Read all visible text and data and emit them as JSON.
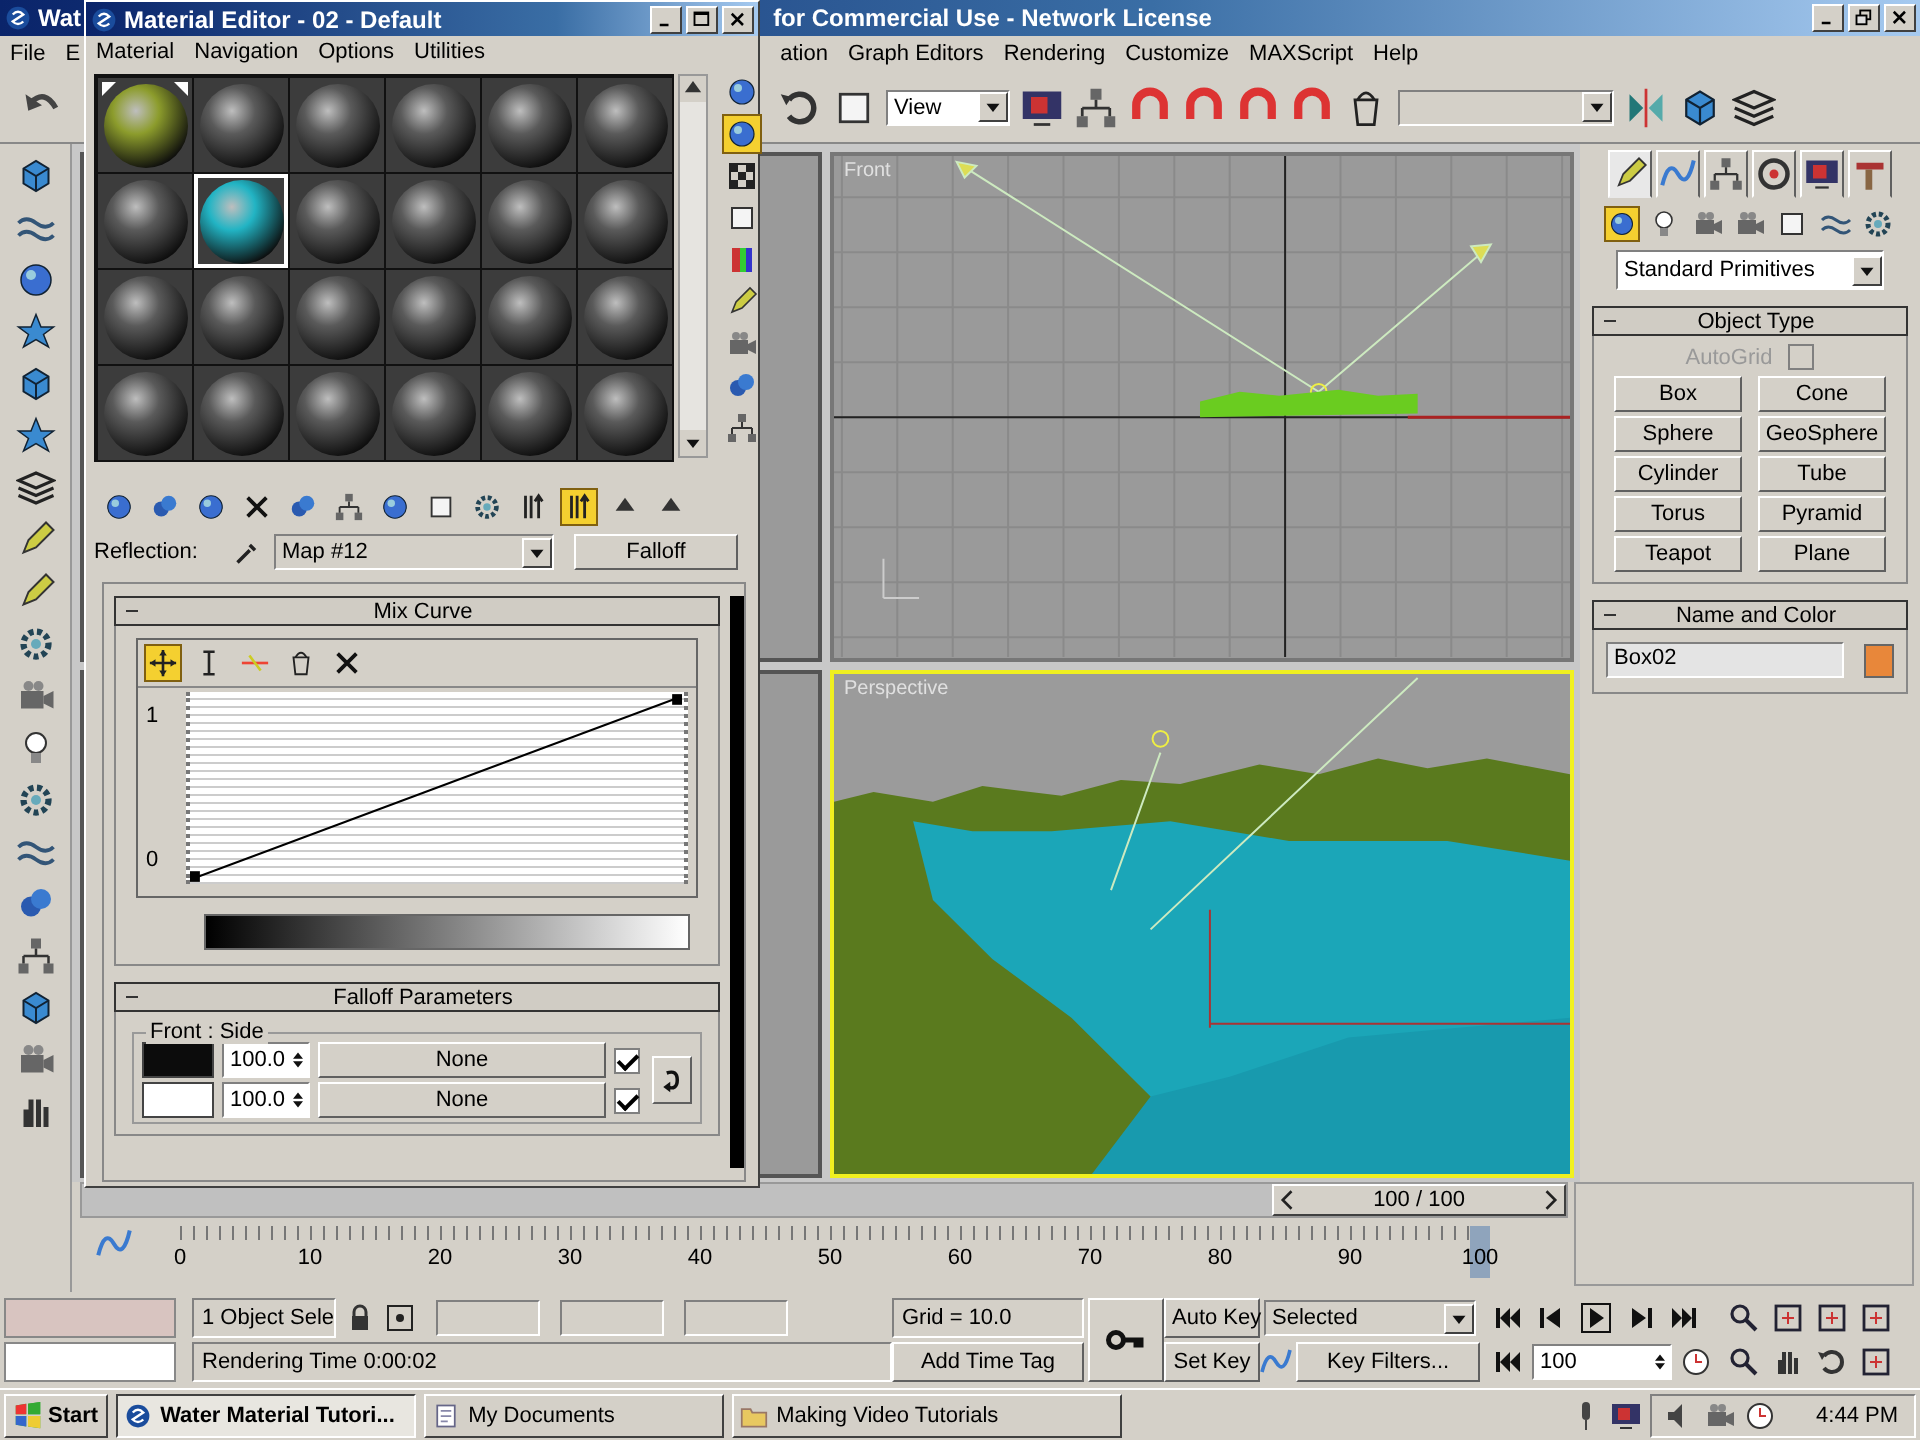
{
  "main_window": {
    "title_left": "Wat",
    "title_right": "for Commercial Use - Network License",
    "menu": [
      "File",
      "E",
      "ation",
      "Graph Editors",
      "Rendering",
      "Customize",
      "MAXScript",
      "Help"
    ],
    "view_dropdown": "View"
  },
  "viewports": [
    {
      "label": "Front",
      "active": false
    },
    {
      "label": "Perspective",
      "active": true
    }
  ],
  "command_panel": {
    "tabs": [
      {
        "selected": true
      },
      {
        "selected": false
      },
      {
        "selected": false
      },
      {
        "selected": false
      },
      {
        "selected": false
      },
      {
        "selected": false
      }
    ],
    "categories": [
      {
        "selected": true
      },
      {
        "selected": false
      },
      {
        "selected": false
      },
      {
        "selected": false
      },
      {
        "selected": false
      },
      {
        "selected": false
      },
      {
        "selected": false
      }
    ],
    "dropdown": "Standard Primitives",
    "object_type": {
      "title": "Object Type",
      "autogrid": {
        "label": "AutoGrid",
        "checked": false,
        "disabled": true
      },
      "buttons": [
        "Box",
        "Cone",
        "Sphere",
        "GeoSphere",
        "Cylinder",
        "Tube",
        "Torus",
        "Pyramid",
        "Teapot",
        "Plane"
      ]
    },
    "name_and_color": {
      "title": "Name and Color",
      "name": "Box02",
      "color": "#e8873a"
    }
  },
  "material_editor": {
    "title": "Material Editor - 02 - Default",
    "menu": [
      "Material",
      "Navigation",
      "Options",
      "Utilities"
    ],
    "slots": [
      {
        "color": "#8c9c2c",
        "hot": true,
        "selected": false
      },
      {
        "color": "#5a5a5a",
        "hot": false,
        "selected": false
      },
      {
        "color": "#5a5a5a",
        "hot": false,
        "selected": false
      },
      {
        "color": "#5a5a5a",
        "hot": false,
        "selected": false
      },
      {
        "color": "#5a5a5a",
        "hot": false,
        "selected": false
      },
      {
        "color": "#5a5a5a",
        "hot": false,
        "selected": false
      },
      {
        "color": "#5a5a5a",
        "hot": false,
        "selected": false
      },
      {
        "color": "#22b4c4",
        "hot": false,
        "selected": true
      },
      {
        "color": "#5a5a5a",
        "hot": false,
        "selected": false
      },
      {
        "color": "#5a5a5a",
        "hot": false,
        "selected": false
      },
      {
        "color": "#5a5a5a",
        "hot": false,
        "selected": false
      },
      {
        "color": "#5a5a5a",
        "hot": false,
        "selected": false
      },
      {
        "color": "#5a5a5a",
        "hot": false,
        "selected": false
      },
      {
        "color": "#5a5a5a",
        "hot": false,
        "selected": false
      },
      {
        "color": "#5a5a5a",
        "hot": false,
        "selected": false
      },
      {
        "color": "#5a5a5a",
        "hot": false,
        "selected": false
      },
      {
        "color": "#5a5a5a",
        "hot": false,
        "selected": false
      },
      {
        "color": "#5a5a5a",
        "hot": false,
        "selected": false
      },
      {
        "color": "#5a5a5a",
        "hot": false,
        "selected": false
      },
      {
        "color": "#5a5a5a",
        "hot": false,
        "selected": false
      },
      {
        "color": "#5a5a5a",
        "hot": false,
        "selected": false
      },
      {
        "color": "#5a5a5a",
        "hot": false,
        "selected": false
      },
      {
        "color": "#5a5a5a",
        "hot": false,
        "selected": false
      },
      {
        "color": "#5a5a5a",
        "hot": false,
        "selected": false
      }
    ],
    "side_tools": [
      {
        "on": false
      },
      {
        "on": true
      },
      {
        "on": false
      },
      {
        "on": false
      },
      {
        "on": false
      },
      {
        "on": false
      },
      {
        "on": false
      },
      {
        "on": false
      },
      {
        "on": false
      }
    ],
    "tools": [
      {
        "on": false
      },
      {
        "on": false
      },
      {
        "on": false
      },
      {
        "on": false
      },
      {
        "on": false
      },
      {
        "on": false
      },
      {
        "on": false
      },
      {
        "on": false
      },
      {
        "on": false
      },
      {
        "on": false
      },
      {
        "on": true
      },
      {
        "on": false
      },
      {
        "on": false
      }
    ],
    "reflection_label": "Reflection:",
    "map_name": "Map #12",
    "map_type": "Falloff",
    "mix_curve": {
      "title": "Mix Curve",
      "tools": [
        {
          "on": true
        },
        {
          "on": false
        },
        {
          "on": false
        },
        {
          "on": false
        },
        {
          "on": false
        }
      ],
      "y_max": "1",
      "y_min": "0"
    },
    "falloff": {
      "title": "Falloff Parameters",
      "group": "Front : Side",
      "rows": [
        {
          "color": "#0c0c0c",
          "amount": "100.0",
          "map": "None",
          "checked": true
        },
        {
          "color": "#ffffff",
          "amount": "100.0",
          "map": "None",
          "checked": true
        }
      ]
    }
  },
  "time_slider": {
    "frame": "100 / 100",
    "level": 1
  },
  "track_bar": {
    "ticks": [
      "0",
      "10",
      "20",
      "30",
      "40",
      "50",
      "60",
      "70",
      "80",
      "90",
      "100"
    ]
  },
  "status_bar": {
    "selection": "1 Object Sele",
    "prompt": "Rendering Time  0:00:02",
    "grid": "Grid = 10.0",
    "add_time_tag": "Add Time Tag",
    "auto_key": "Auto Key",
    "set_key": "Set Key",
    "key_mode": "Selected",
    "key_filters": "Key Filters...",
    "frame": "100"
  },
  "taskbar": {
    "start": "Start",
    "tasks": [
      {
        "label": "Water Material Tutori...",
        "selected": true
      },
      {
        "label": "My Documents",
        "selected": false
      },
      {
        "label": "Making Video Tutorials",
        "selected": false
      }
    ],
    "clock": "4:44 PM"
  }
}
